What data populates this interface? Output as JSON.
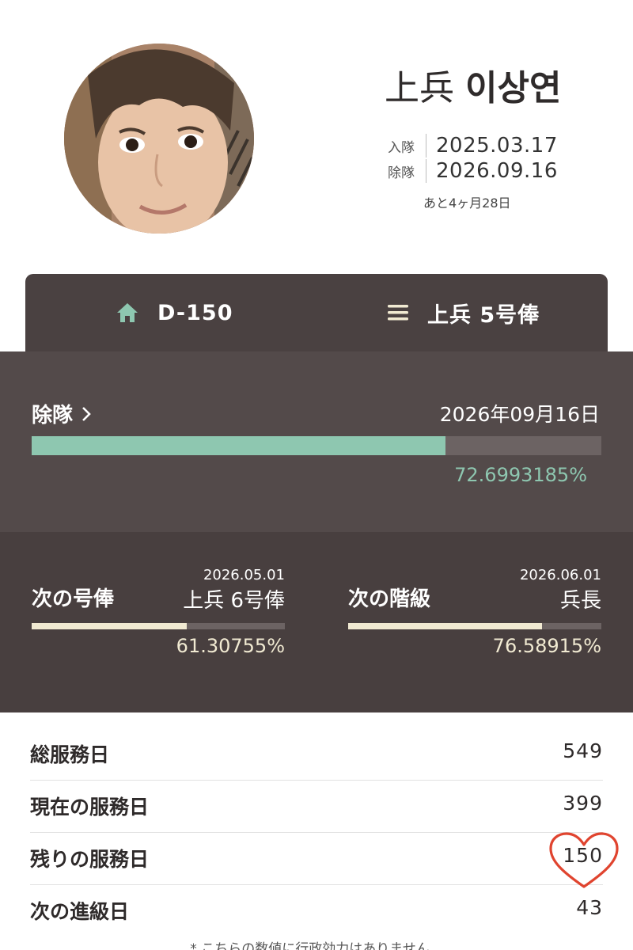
{
  "profile": {
    "rank": "上兵",
    "name": "이상연",
    "enlist_label": "入隊",
    "enlist_date": "2025.03.17",
    "discharge_label": "除隊",
    "discharge_date": "2026.09.16",
    "remaining": "あと4ヶ月28日"
  },
  "tabs": [
    {
      "label": "D-150",
      "icon": "home-icon",
      "active": true
    },
    {
      "label": "上兵 5号俸",
      "icon": "menu-icon",
      "active": false
    }
  ],
  "discharge": {
    "title": "除隊",
    "date": "2026年09月16日",
    "percent_text": "72.6993185%",
    "progress": 0.726993185
  },
  "next": [
    {
      "label": "次の号俸",
      "date": "2026.05.01",
      "value": "上兵 6号俸",
      "percent_text": "61.30755%",
      "progress": 0.6130755
    },
    {
      "label": "次の階級",
      "date": "2026.06.01",
      "value": "兵長",
      "percent_text": "76.58915%",
      "progress": 0.7658915
    }
  ],
  "stats": [
    {
      "label": "総服務日",
      "value": "549"
    },
    {
      "label": "現在の服務日",
      "value": "399"
    },
    {
      "label": "残りの服務日",
      "value": "150"
    },
    {
      "label": "次の進級日",
      "value": "43"
    }
  ],
  "footnote": "* こちらの数値に行政効力はありません。",
  "colors": {
    "accent": "#8ec7b0",
    "cream": "#f1ead2",
    "tab_bg": "#4a4141",
    "section_bg": "#534a4a",
    "heart": "#e0442f"
  }
}
